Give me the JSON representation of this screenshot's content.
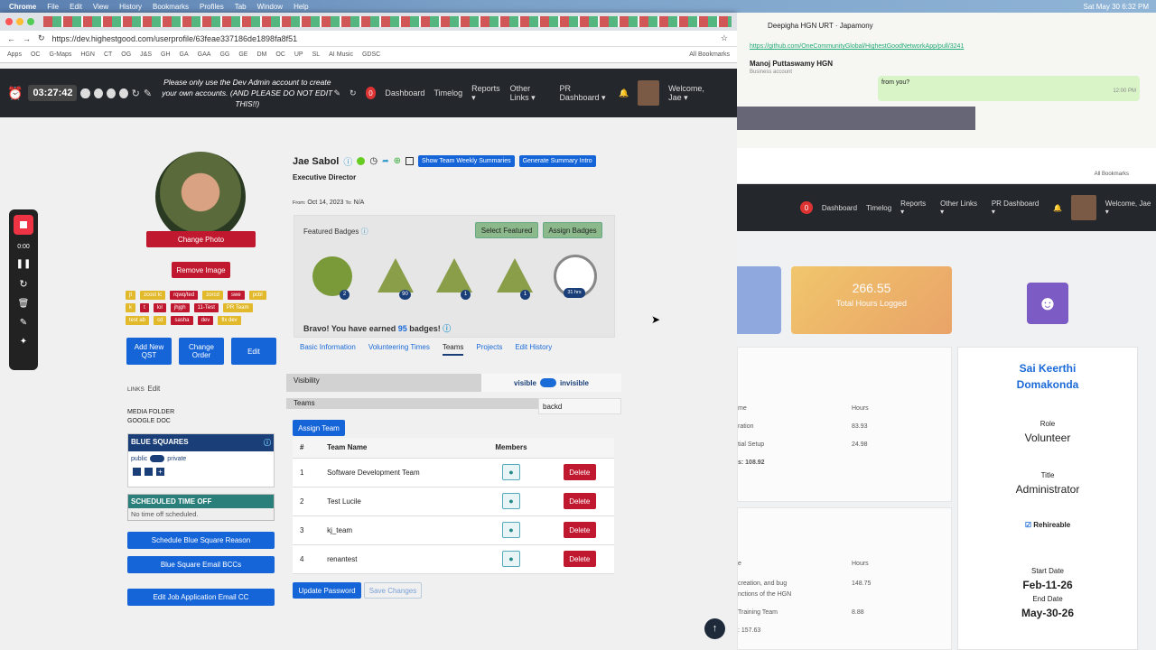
{
  "mac": {
    "app": "Chrome",
    "menus": [
      "File",
      "Edit",
      "View",
      "History",
      "Bookmarks",
      "Profiles",
      "Tab",
      "Window",
      "Help"
    ],
    "datetime": "Sat May 30  6:32 PM"
  },
  "browser": {
    "url": "https://dev.highestgood.com/userprofile/63feae337186de1898fa8f51",
    "bookmarks": [
      "Apps",
      "OC",
      "G-Maps",
      "HGN",
      "CT",
      "OG",
      "J&S",
      "GH",
      "GA",
      "GAA",
      "GG",
      "GE",
      "DM",
      "OC",
      "UP",
      "SL",
      "AI Music",
      "GDSC"
    ],
    "all_bookmarks": "All Bookmarks"
  },
  "nav": {
    "timer": "03:27:42",
    "note": "Please only use the Dev Admin account to create your own accounts. (AND PLEASE DO NOT EDIT THIS!!)",
    "notif_count": "0",
    "links": [
      "Dashboard",
      "Timelog",
      "Reports",
      "Other Links",
      "PR Dashboard"
    ],
    "welcome": "Welcome, Jae"
  },
  "recorder": {
    "time": "0:00"
  },
  "profile": {
    "change_photo": "Change Photo",
    "remove_image": "Remove Image",
    "tags": [
      "jt",
      "zcost lc",
      "rqwq/ted",
      "zorcd",
      "swe",
      "pcbl",
      "k",
      "t",
      "lol",
      "jhjgh",
      "11-Test",
      "PR Team",
      "test ab",
      "cd",
      "sasha",
      "dev",
      "flx dev"
    ],
    "add_qst": "Add New QST",
    "change_order": "Change Order",
    "edit": "Edit",
    "links_label": "LINKS",
    "links_edit": "Edit",
    "media_folder": "MEDIA FOLDER",
    "google_doc": "GOOGLE DOC",
    "blue_squares": "BLUE SQUARES",
    "public": "public",
    "private": "private",
    "scheduled_time_off": "SCHEDULED TIME OFF",
    "no_time_off": "No time off scheduled.",
    "schedule_bs_reason": "Schedule Blue Square Reason",
    "bs_email_bccs": "Blue Square Email BCCs",
    "edit_job_email": "Edit Job Application Email CC",
    "name": "Jae Sabol",
    "show_weekly": "Show Team Weekly Summaries",
    "gen_summary": "Generate Summary Intro",
    "title": "Executive Director",
    "from_label": "From:",
    "from_date": "Oct 14, 2023",
    "to_label": "To:",
    "to_date": "N/A",
    "featured_badges": "Featured Badges",
    "select_featured": "Select Featured",
    "assign_badges": "Assign Badges",
    "badge_counts": [
      "2",
      "90",
      "1",
      "1",
      "31 hrs"
    ],
    "bravo_pre": "Bravo! You have earned ",
    "bravo_count": "95",
    "bravo_post": " badges!",
    "tabs": [
      "Basic Information",
      "Volunteering Times",
      "Teams",
      "Projects",
      "Edit History"
    ],
    "visibility": "Visibility",
    "visible": "visible",
    "invisible": "invisible",
    "teams_label": "Teams",
    "teams_code": "backd",
    "assign_team": "Assign Team",
    "table_headers": [
      "#",
      "Team Name",
      "Members",
      ""
    ],
    "teams": [
      {
        "n": "1",
        "name": "Software Development Team"
      },
      {
        "n": "2",
        "name": "Test Lucile"
      },
      {
        "n": "3",
        "name": "kj_team"
      },
      {
        "n": "4",
        "name": "renantest"
      }
    ],
    "delete": "Delete",
    "update_password": "Update Password",
    "save_changes": "Save Changes"
  },
  "chat": {
    "contact1": "Deepigha HGN URT",
    "contact1_sub": "Japamony",
    "url": "https://github.com/OneCommunityGlobal/HighestGoodNetworkApp/pull/3241",
    "contact2": "Manoj Puttaswamy HGN",
    "contact2_sub": "Business account",
    "msg": "from you?",
    "msg_time": "12:00 PM"
  },
  "right": {
    "notif": "0",
    "links": [
      "Dashboard",
      "Timelog",
      "Reports",
      "Other Links",
      "PR Dashboard"
    ],
    "welcome": "Welcome, Jae",
    "hours_value": "266.55",
    "hours_label": "Total Hours Logged",
    "name": "Sai Keerthi Domakonda",
    "role_label": "Role",
    "role": "Volunteer",
    "title_label": "Title",
    "title": "Administrator",
    "rehireable": "Rehireable",
    "start_label": "Start Date",
    "start": "Feb-11-26",
    "end_label": "End Date",
    "end": "May-30-26",
    "t1_headers": [
      "me",
      "Hours"
    ],
    "t1_rows": [
      [
        "ration",
        "83.93"
      ],
      [
        "tial Setup",
        "24.98"
      ]
    ],
    "t1_total": "s: 108.92",
    "t2_headers": [
      "e",
      "Hours"
    ],
    "t2_rows": [
      [
        "creation, and bug",
        "148.75"
      ],
      [
        "nctions of the HGN",
        ""
      ],
      [
        "Training Team",
        "8.88"
      ]
    ],
    "t2_total": ": 157.63"
  }
}
